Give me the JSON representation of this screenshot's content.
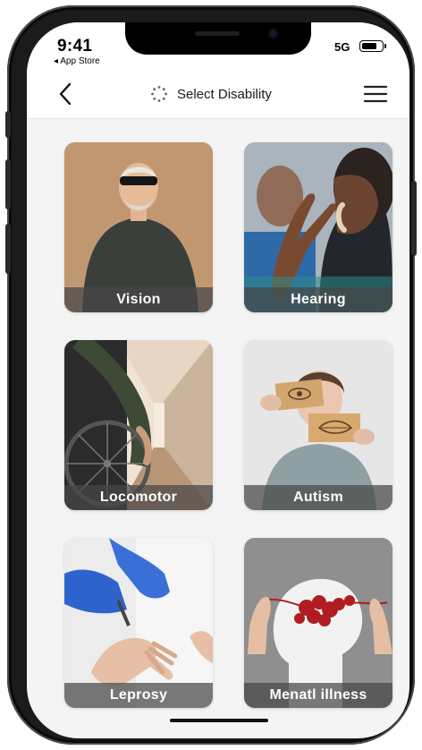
{
  "status_bar": {
    "time": "9:41",
    "back_label": "◂ App Store",
    "network": "5G"
  },
  "nav": {
    "title": "Select Disability",
    "back_icon": "chevron-left-icon",
    "loader_icon": "spinner-icon",
    "menu_icon": "hamburger-menu-icon"
  },
  "cards": [
    {
      "label": "Vision"
    },
    {
      "label": "Hearing"
    },
    {
      "label": "Locomotor"
    },
    {
      "label": "Autism"
    },
    {
      "label": "Leprosy"
    },
    {
      "label": "Menatl illness"
    }
  ],
  "colors": {
    "label_overlay": "#464646",
    "screen_bg": "#f4f4f4"
  }
}
